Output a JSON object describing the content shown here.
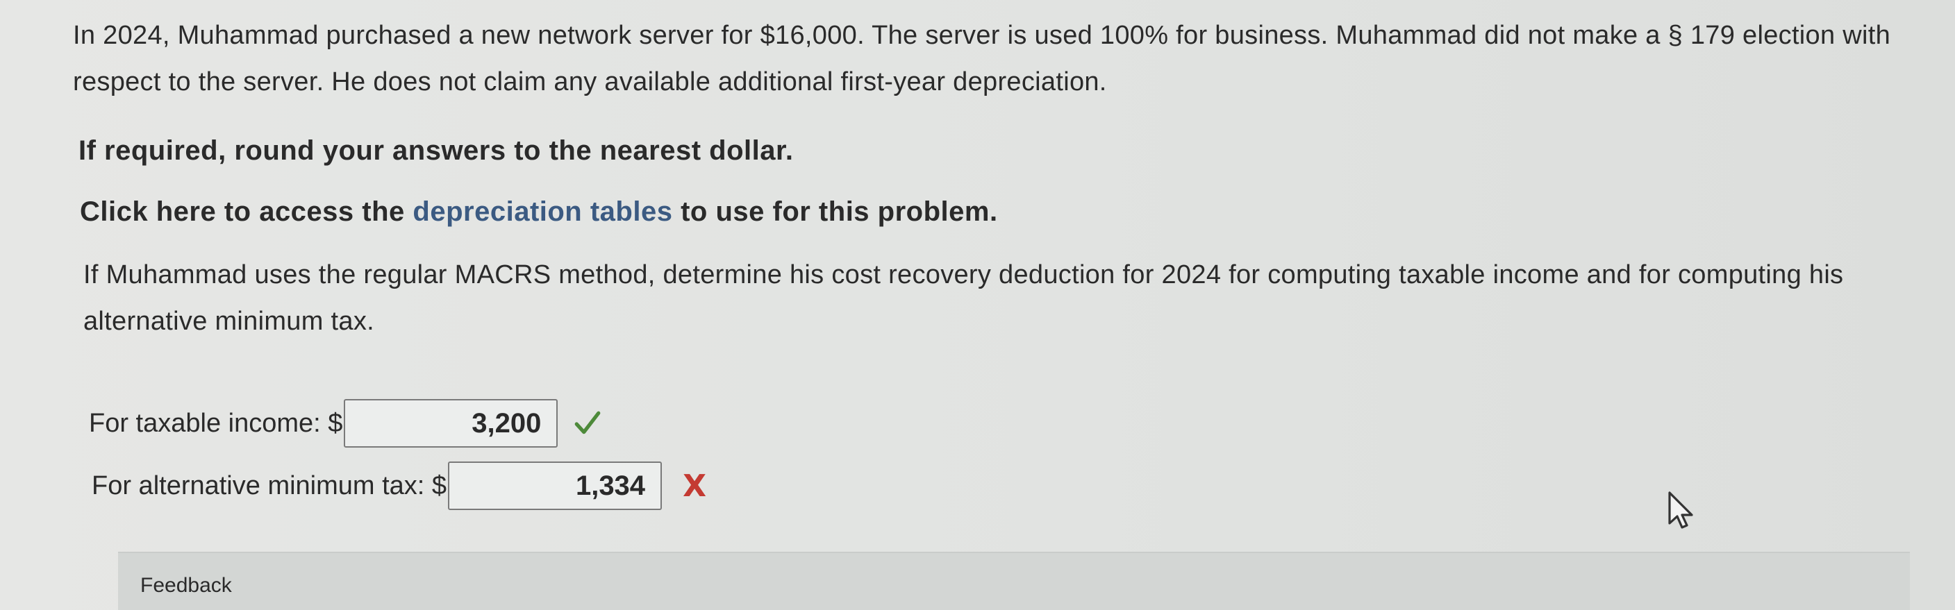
{
  "question": {
    "intro": "In 2024, Muhammad purchased a new network server for $16,000. The server is used 100% for business. Muhammad did not make a § 179 election with respect to the server. He does not claim any available additional first-year depreciation.",
    "rounding_instruction": "If required, round your answers to the nearest dollar.",
    "tables_prefix": "Click here to access the",
    "tables_link": "depreciation tables",
    "tables_suffix": "to use for this problem.",
    "prompt": "If Muhammad uses the regular MACRS method, determine his cost recovery deduction for 2024 for computing taxable income and for computing his alternative minimum tax."
  },
  "answers": [
    {
      "label": "For taxable income: $",
      "value": "3,200",
      "status": "correct"
    },
    {
      "label": "For alternative minimum tax: $",
      "value": "1,334",
      "status": "incorrect"
    }
  ],
  "icons": {
    "correct": "checkmark-icon",
    "incorrect": "x-mark-icon",
    "cursor": "mouse-pointer-icon"
  },
  "status_glyph_incorrect": "X",
  "feedback": {
    "label": "Feedback"
  },
  "colors": {
    "link": "#3b5a82",
    "correct": "#4d8a3a",
    "incorrect": "#c43a32"
  }
}
